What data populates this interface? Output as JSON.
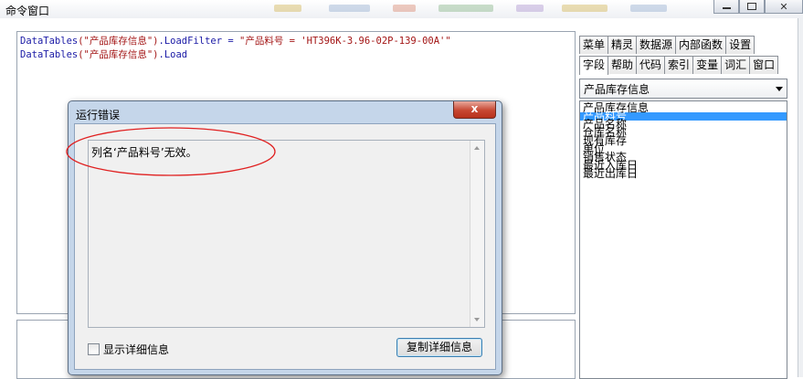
{
  "window": {
    "title": "命令窗口"
  },
  "editor": {
    "line1": {
      "dt": "DataTables",
      "args": "(\"产品库存信息\")",
      "method": ".LoadFilter = ",
      "filter": "\"产品料号 = 'HT396K-3.96-02P-139-00A'\""
    },
    "line2": {
      "dt": "DataTables",
      "args": "(\"产品库存信息\")",
      "method": ".Load"
    }
  },
  "side_panel": {
    "tabs_row1": [
      "菜单",
      "精灵",
      "数据源",
      "内部函数",
      "设置"
    ],
    "tabs_row2": [
      "字段",
      "帮助",
      "代码",
      "索引",
      "变量",
      "词汇",
      "窗口"
    ],
    "active_tab": "字段",
    "combo_value": "产品库存信息",
    "list_items": [
      "产品库存信息",
      "产品料号",
      "产品名称",
      "仓库名称",
      "现有库存",
      "单位",
      "销售状态",
      "最近入库日",
      "最近出库日"
    ],
    "selected_item": "产品料号"
  },
  "dialog": {
    "title": "运行错误",
    "close_label": "x",
    "message": "列名‘产品料号’无效。",
    "checkbox_label": "显示详细信息",
    "copy_button": "复制详细信息"
  },
  "colors": {
    "annotation": "#e02020",
    "selection": "#3399ff",
    "close_button": "#c74732"
  }
}
